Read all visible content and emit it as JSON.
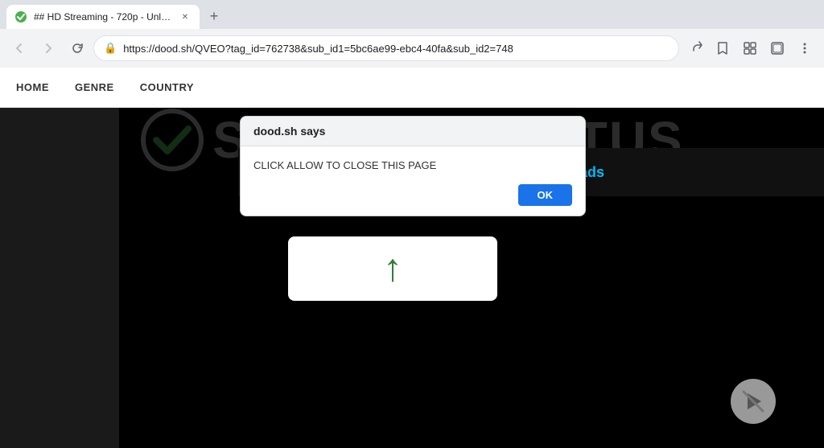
{
  "browser": {
    "tab": {
      "title": "## HD Streaming - 720p - Unlim...",
      "favicon": "🎬"
    },
    "new_tab_label": "+",
    "nav": {
      "back_title": "Back",
      "forward_title": "Forward",
      "refresh_title": "Refresh"
    },
    "address_bar": {
      "url": "https://dood.sh/QVEO?tag_id=762738&sub_id1=5bc6ae99-ebc4-40fa&sub_id2=748"
    },
    "toolbar_icons": {
      "share": "⬆",
      "bookmark": "☆",
      "extension": "🧩",
      "split": "⬜",
      "menu": "⋮"
    }
  },
  "site": {
    "nav": {
      "items": [
        "HOME",
        "GENRE",
        "COUNTRY"
      ]
    },
    "watermark": {
      "text": "SECUREDSTATUS"
    },
    "info_bar": {
      "title": "HD Streaming - 720p - Unlimited Downloads"
    }
  },
  "dialog": {
    "header": "dood.sh says",
    "body": "CLICK ALLOW TO CLOSE THIS PAGE",
    "ok_label": "OK"
  }
}
